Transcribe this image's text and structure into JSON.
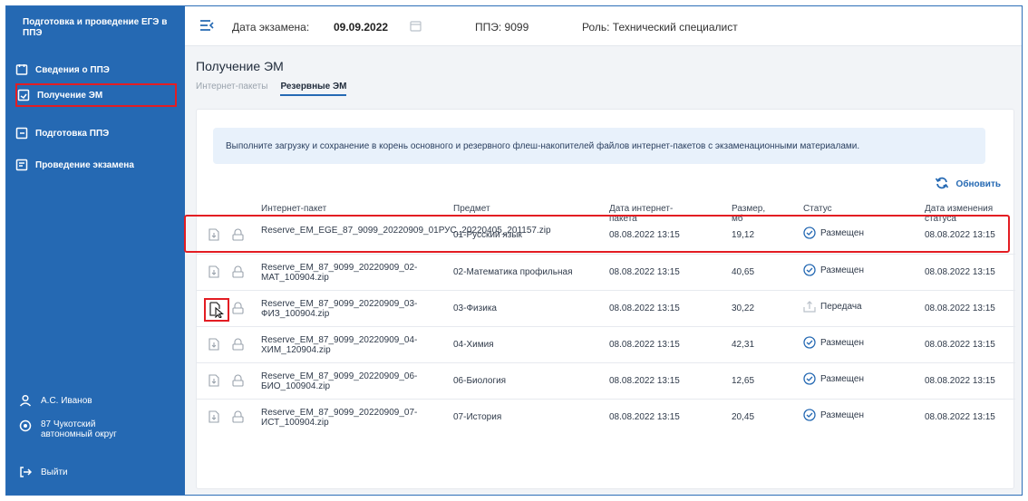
{
  "sidebar": {
    "title": "Подготовка и проведение ЕГЭ в ППЭ",
    "items": [
      {
        "label": "Сведения о ППЭ",
        "icon": "calendar-icon"
      },
      {
        "label": "Получение ЭМ",
        "icon": "download-file-icon"
      },
      {
        "label": "Подготовка ППЭ",
        "icon": "prepare-icon"
      },
      {
        "label": "Проведение экзамена",
        "icon": "exam-icon"
      }
    ],
    "user": "А.С. Иванов",
    "region": "87 Чукотский автономный округ",
    "logout": "Выйти"
  },
  "header": {
    "date_label": "Дата экзамена:",
    "date_value": "09.09.2022",
    "ppe": "ППЭ: 9099",
    "role": "Роль: Технический специалист"
  },
  "page": {
    "title": "Получение ЭМ",
    "tabs": [
      "Интернет-пакеты",
      "Резервные ЭМ"
    ]
  },
  "info_text": "Выполните загрузку и сохранение в корень основного и резервного флеш-накопителей файлов интернет-пакетов с экзаменационными материалами.",
  "refresh_label": "Обновить",
  "table": {
    "headers": [
      "Интернет-пакет",
      "Предмет",
      "Дата интернет-пакета",
      "Размер, мб",
      "Статус",
      "Дата изменения статуса"
    ],
    "rows": [
      {
        "file": "Reserve_EM_EGE_87_9099_20220909_01РУС_20220405_201157.zip",
        "subject": "01-Русский язык",
        "date": "08.08.2022 13:15",
        "size": "19,12",
        "status": "Размещен",
        "changed": "08.08.2022 13:15"
      },
      {
        "file": "Reserve_EM_87_9099_20220909_02-МАТ_100904.zip",
        "subject": "02-Математика профильная",
        "date": "08.08.2022 13:15",
        "size": "40,65",
        "status": "Размещен",
        "changed": "08.08.2022 13:15"
      },
      {
        "file": "Reserve_EM_87_9099_20220909_03-ФИЗ_100904.zip",
        "subject": "03-Физика",
        "date": "08.08.2022 13:15",
        "size": "30,22",
        "status": "Передача",
        "changed": "08.08.2022 13:15"
      },
      {
        "file": "Reserve_EM_87_9099_20220909_04-ХИМ_120904.zip",
        "subject": "04-Химия",
        "date": "08.08.2022 13:15",
        "size": "42,31",
        "status": "Размещен",
        "changed": "08.08.2022 13:15"
      },
      {
        "file": "Reserve_EM_87_9099_20220909_06-БИО_100904.zip",
        "subject": "06-Биология",
        "date": "08.08.2022 13:15",
        "size": "12,65",
        "status": "Размещен",
        "changed": "08.08.2022 13:15"
      },
      {
        "file": "Reserve_EM_87_9099_20220909_07-ИСТ_100904.zip",
        "subject": "07-История",
        "date": "08.08.2022 13:15",
        "size": "20,45",
        "status": "Размещен",
        "changed": "08.08.2022 13:15"
      }
    ]
  },
  "colors": {
    "sidebar": "#2569b3",
    "highlight": "#e31d23",
    "accent": "#2569b3"
  }
}
